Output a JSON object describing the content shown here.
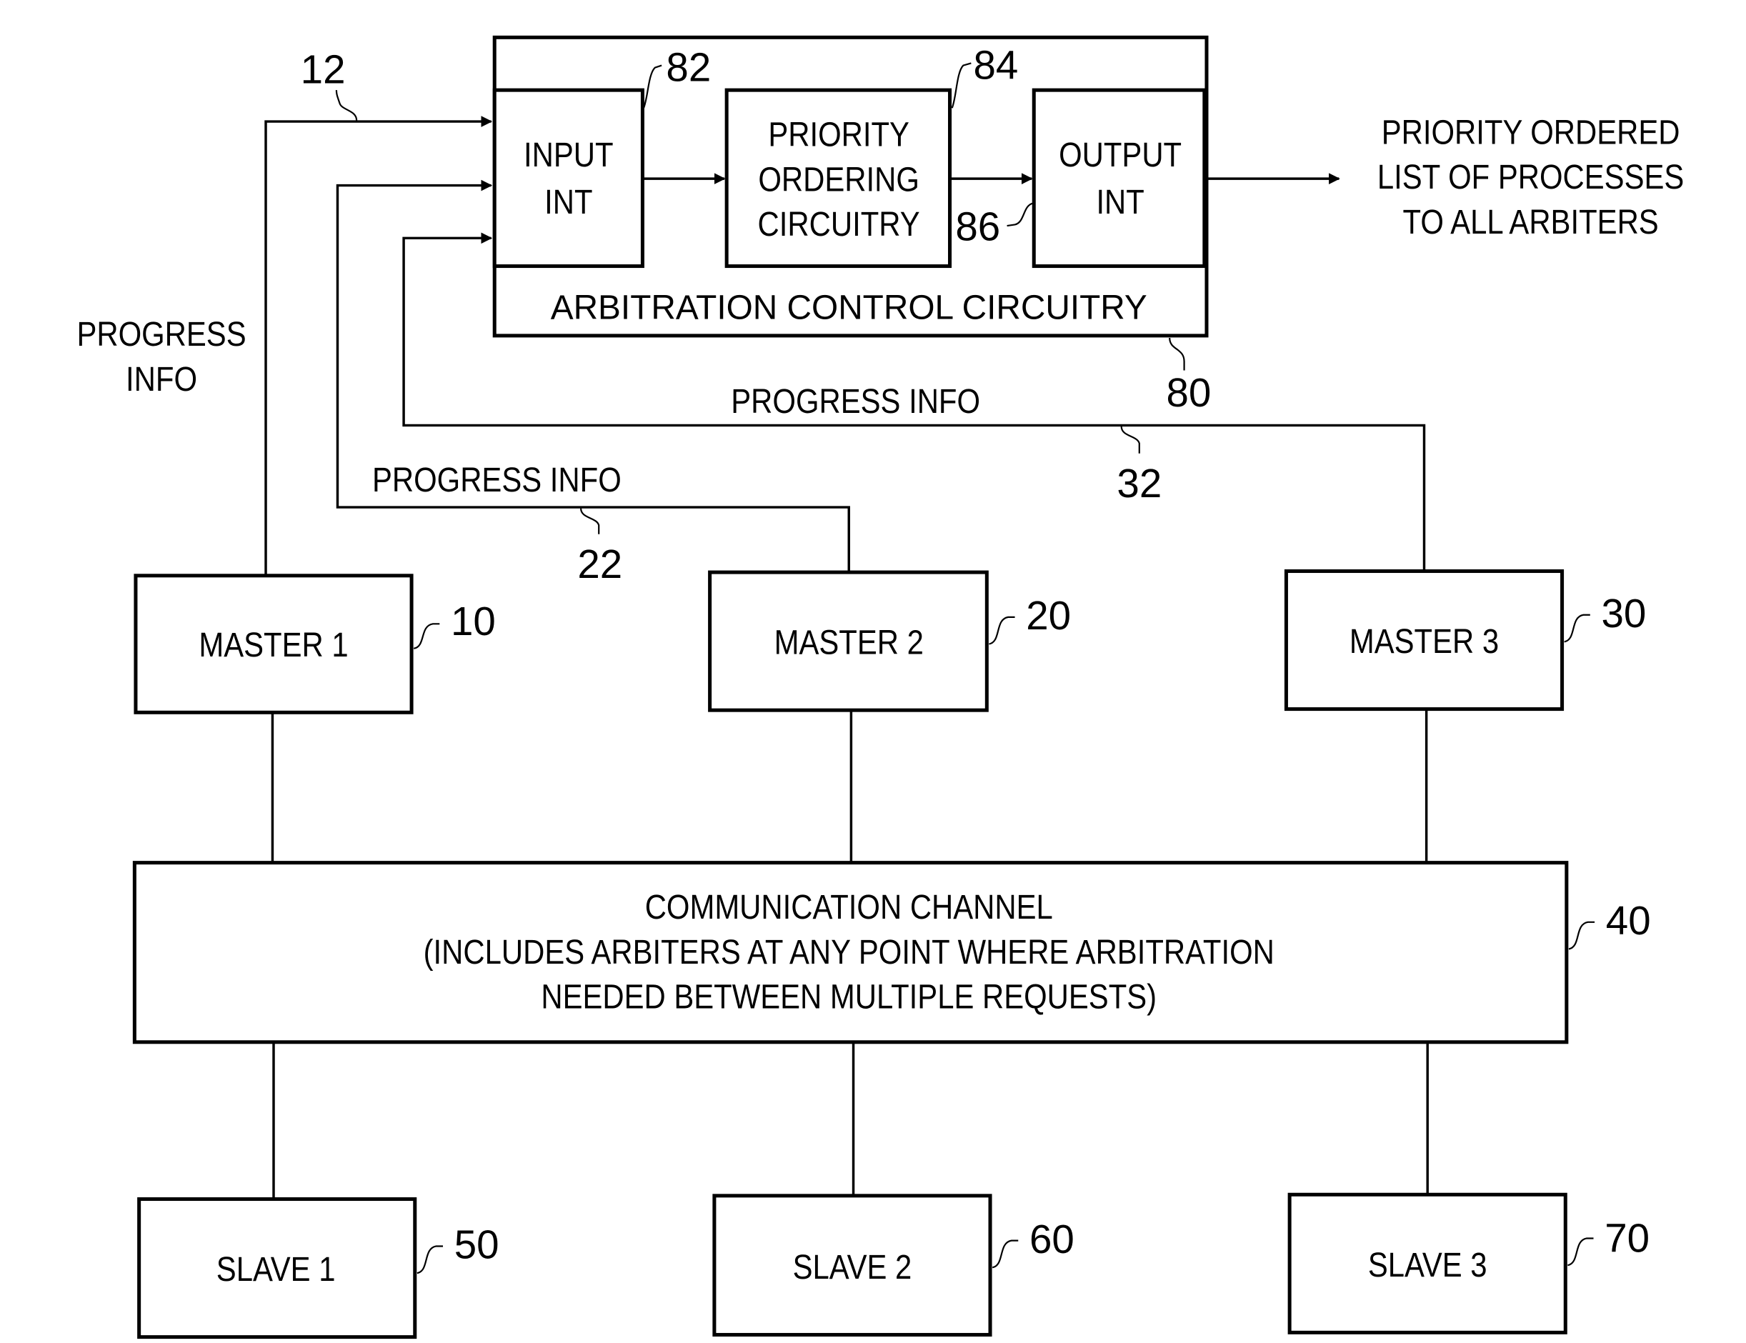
{
  "arbitration": {
    "outer_label": "ARBITRATION CONTROL CIRCUITRY",
    "outer_ref": "80",
    "input_int": {
      "line1": "INPUT",
      "line2": "INT",
      "ref": "82"
    },
    "priority_ordering": {
      "line1": "PRIORITY",
      "line2": "ORDERING",
      "line3": "CIRCUITRY",
      "ref": "84"
    },
    "output_int": {
      "line1": "OUTPUT",
      "line2": "INT",
      "ref": "86"
    },
    "output_text": {
      "line1": "PRIORITY ORDERED",
      "line2": "LIST OF PROCESSES",
      "line3": "TO ALL ARBITERS"
    }
  },
  "progress_links": [
    {
      "label_line1": "PROGRESS",
      "label_line2": "INFO",
      "ref": "12"
    },
    {
      "label": "PROGRESS INFO",
      "ref": "22"
    },
    {
      "label": "PROGRESS INFO",
      "ref": "32"
    }
  ],
  "masters": [
    {
      "label": "MASTER 1",
      "ref": "10"
    },
    {
      "label": "MASTER 2",
      "ref": "20"
    },
    {
      "label": "MASTER 3",
      "ref": "30"
    }
  ],
  "channel": {
    "line1": "COMMUNICATION CHANNEL",
    "line2": "(INCLUDES ARBITERS AT ANY POINT WHERE ARBITRATION",
    "line3": "NEEDED BETWEEN MULTIPLE REQUESTS)",
    "ref": "40"
  },
  "slaves": [
    {
      "label": "SLAVE 1",
      "ref": "50"
    },
    {
      "label": "SLAVE 2",
      "ref": "60"
    },
    {
      "label": "SLAVE 3",
      "ref": "70"
    }
  ]
}
